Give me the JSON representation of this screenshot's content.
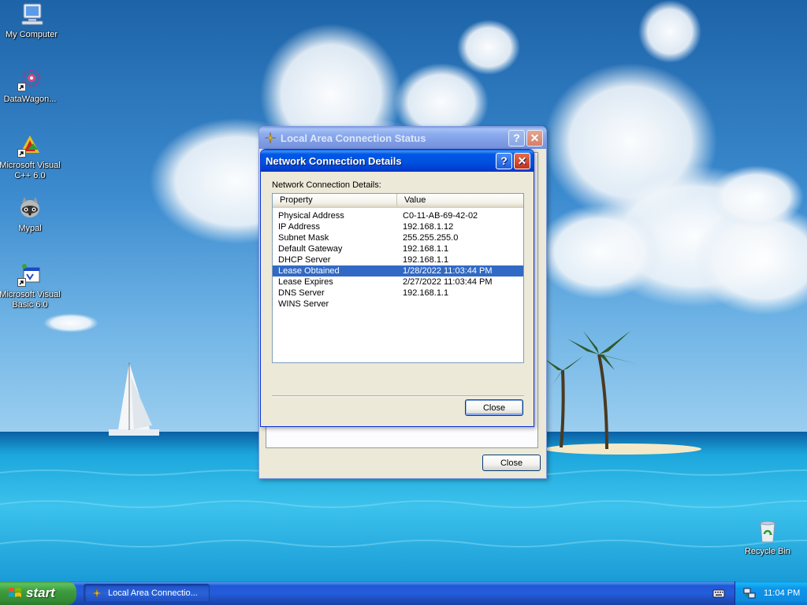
{
  "desktop": {
    "icons": [
      {
        "label": "My Computer"
      },
      {
        "label": "DataWagon..."
      },
      {
        "label": "Microsoft Visual C++ 6.0"
      },
      {
        "label": "Mypal"
      },
      {
        "label": "Microsoft Visual Basic 6.0"
      },
      {
        "label": "Recycle Bin"
      }
    ]
  },
  "status_window": {
    "title": "Local Area Connection Status",
    "close_button": "Close"
  },
  "details_dialog": {
    "title": "Network Connection Details",
    "label": "Network Connection Details:",
    "columns": [
      "Property",
      "Value"
    ],
    "rows": [
      {
        "property": "Physical Address",
        "value": "C0-11-AB-69-42-02",
        "selected": false
      },
      {
        "property": "IP Address",
        "value": "192.168.1.12",
        "selected": false
      },
      {
        "property": "Subnet Mask",
        "value": "255.255.255.0",
        "selected": false
      },
      {
        "property": "Default Gateway",
        "value": "192.168.1.1",
        "selected": false
      },
      {
        "property": "DHCP Server",
        "value": "192.168.1.1",
        "selected": false
      },
      {
        "property": "Lease Obtained",
        "value": "1/28/2022 11:03:44 PM",
        "selected": true
      },
      {
        "property": "Lease Expires",
        "value": "2/27/2022 11:03:44 PM",
        "selected": false
      },
      {
        "property": "DNS Server",
        "value": "192.168.1.1",
        "selected": false
      },
      {
        "property": "WINS Server",
        "value": "",
        "selected": false
      }
    ],
    "close_button": "Close"
  },
  "taskbar": {
    "start_label": "start",
    "task_item": "Local Area Connectio...",
    "clock": "11:04 PM"
  },
  "colors": {
    "selection": "#316ac5",
    "title_active": "#0054e3",
    "taskbar": "#245ddb",
    "start_green": "#3e9d3e",
    "window_face": "#ece9d8"
  }
}
